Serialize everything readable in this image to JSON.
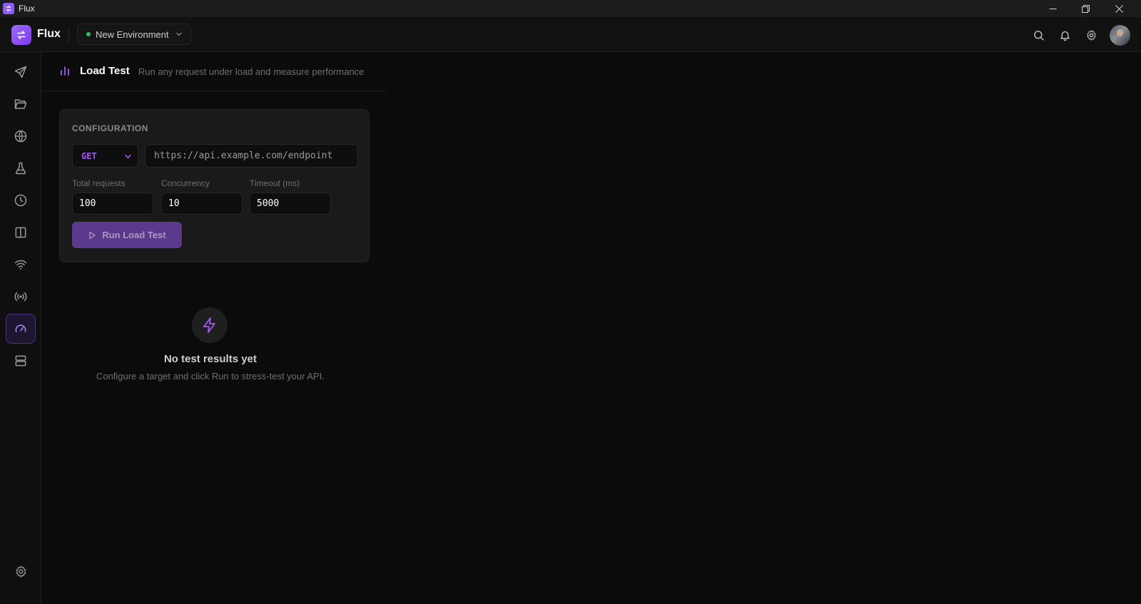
{
  "window": {
    "title": "Flux"
  },
  "header": {
    "brand": "Flux",
    "environment": {
      "label": "New Environment",
      "status_color": "#22c55e"
    },
    "icons": [
      "search-icon",
      "bell-icon",
      "gear-icon"
    ]
  },
  "sidebar": {
    "items": [
      {
        "name": "send-icon",
        "active": false
      },
      {
        "name": "folder-open-icon",
        "active": false
      },
      {
        "name": "globe-icon",
        "active": false
      },
      {
        "name": "flask-icon",
        "active": false
      },
      {
        "name": "clock-icon",
        "active": false
      },
      {
        "name": "columns-icon",
        "active": false
      },
      {
        "name": "wifi-icon",
        "active": false
      },
      {
        "name": "broadcast-icon",
        "active": false
      },
      {
        "name": "gauge-icon",
        "active": true
      },
      {
        "name": "server-icon",
        "active": false
      }
    ],
    "bottom_icon": "gear-icon"
  },
  "page": {
    "title": "Load Test",
    "subtitle": "Run any request under load and measure performance"
  },
  "config": {
    "section_label": "CONFIGURATION",
    "method": "GET",
    "url_placeholder": "https://api.example.com/endpoint",
    "total_requests_label": "Total requests",
    "total_requests_value": "100",
    "concurrency_label": "Concurrency",
    "concurrency_value": "10",
    "timeout_label": "Timeout (ms)",
    "timeout_value": "5000",
    "run_button_label": "Run Load Test"
  },
  "empty_state": {
    "icon": "lightning-icon",
    "title": "No test results yet",
    "subtitle": "Configure a target and click Run to stress-test your API."
  },
  "colors": {
    "accent": "#8b5cf6",
    "method": "#a855f7",
    "run_button": "#5b3a8e",
    "background": "#0b0b0b"
  }
}
